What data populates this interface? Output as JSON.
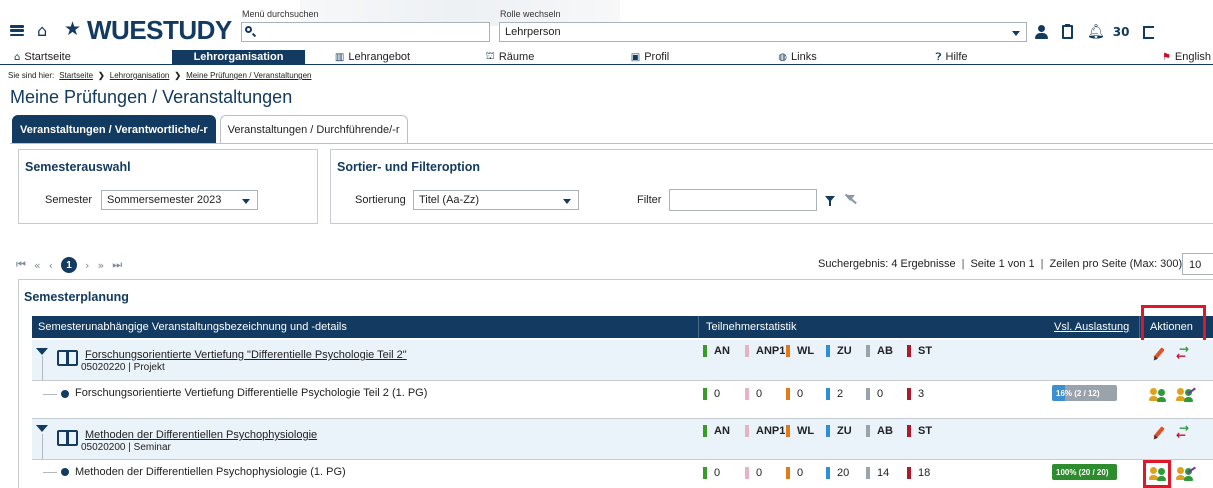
{
  "header": {
    "logo_text": "WUESTUDY",
    "menu_search_label": "Menü durchsuchen",
    "menu_search_value": "",
    "role_label": "Rolle wechseln",
    "role_value": "Lehrperson",
    "count": "30"
  },
  "nav": {
    "items": [
      {
        "label": "Startseite",
        "icon": "home-icon"
      },
      {
        "label": "Lehrorganisation",
        "icon": ""
      },
      {
        "label": "Lehrangebot",
        "icon": "book-icon"
      },
      {
        "label": "Räume",
        "icon": "building-icon"
      },
      {
        "label": "Profil",
        "icon": "profile-icon"
      },
      {
        "label": "Links",
        "icon": "globe-icon"
      },
      {
        "label": "Hilfe",
        "icon": "help-icon"
      },
      {
        "label": "English",
        "icon": "flag-icon"
      }
    ]
  },
  "breadcrumb": {
    "prefix": "Sie sind hier:",
    "items": [
      "Startseite",
      "Lehrorganisation",
      "Meine Prüfungen / Veranstaltungen"
    ]
  },
  "page_title": "Meine Prüfungen / Veranstaltungen",
  "tabs": [
    "Veranstaltungen / Verantwortliche/-r",
    "Veranstaltungen / Durchführende/-r"
  ],
  "semester_panel": {
    "title": "Semesterauswahl",
    "label": "Semester",
    "value": "Sommersemester 2023"
  },
  "sort_panel": {
    "title": "Sortier- und Filteroption",
    "sort_label": "Sortierung",
    "sort_value": "Titel (Aa-Zz)",
    "filter_label": "Filter",
    "filter_value": ""
  },
  "pager": {
    "first": "⏮",
    "prev_block": "«",
    "prev": "‹",
    "current": "1",
    "next": "›",
    "next_block": "»",
    "last": "⏭"
  },
  "results": {
    "count_text": "Suchergebnis: 4 Ergebnisse",
    "page_text": "Seite 1 von 1",
    "rows_label": "Zeilen pro Seite (Max: 300)",
    "rows_value": "10"
  },
  "planning": {
    "title": "Semesterplanung",
    "columns": {
      "name": "Semesterunabhängige Veranstaltungsbezeichnung und -details",
      "stats": "Teilnehmerstatistik",
      "utilization": "Vsl. Auslastung",
      "actions": "Aktionen"
    },
    "stat_headers": [
      "AN",
      "ANP1",
      "WL",
      "ZU",
      "AB",
      "ST"
    ],
    "stat_colors": [
      "#3a9a2a",
      "#e7b3c3",
      "#e07a1e",
      "#2f8fd6",
      "#9aa3ac",
      "#b0182a"
    ],
    "courses": [
      {
        "title": "Forschungsorientierte Vertiefung \"Differentielle Psychologie Teil 2\"",
        "meta": "05020220 | Projekt",
        "group": {
          "title": "Forschungsorientierte Vertiefung Differentielle Psychologie Teil 2 (1. PG)",
          "stats": [
            "0",
            "0",
            "0",
            "2",
            "0",
            "3"
          ],
          "util_text": "16% (2 / 12)",
          "util_fraction": 0.16,
          "util_color": "#3d8fd0"
        }
      },
      {
        "title": "Methoden der Differentiellen Psychophysiologie",
        "meta": "05020200 | Seminar",
        "group": {
          "title": "Methoden der Differentiellen Psychophysiologie (1. PG)",
          "stats": [
            "0",
            "0",
            "0",
            "20",
            "14",
            "18"
          ],
          "util_text": "100% (20 / 20)",
          "util_fraction": 1.0,
          "util_color": "#2e8b2e"
        }
      }
    ]
  },
  "colors": {
    "brand": "#133a60",
    "highlight": "#e0162b"
  }
}
